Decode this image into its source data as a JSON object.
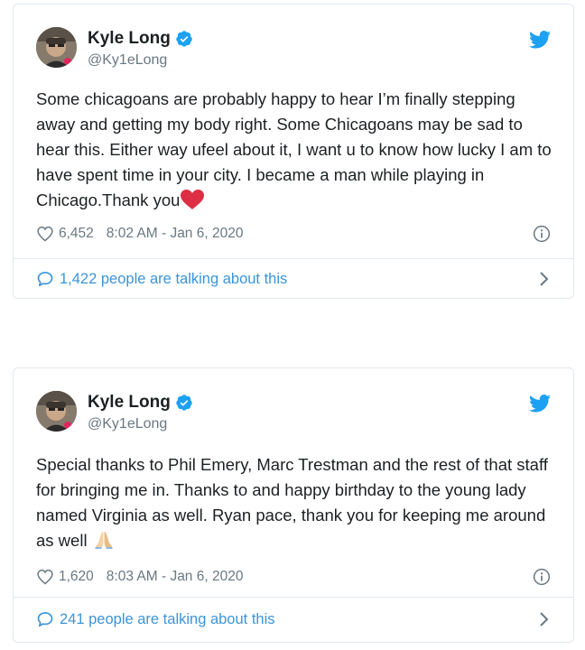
{
  "tweets": [
    {
      "author": {
        "name": "Kyle Long",
        "handle": "@Ky1eLong",
        "verified": true,
        "avatar_icon": "profile-photo"
      },
      "text": "Some chicagoans are probably happy to hear I’m finally stepping away and getting my body right. Some Chicagoans may be sad to hear this. Either way ufeel about it, I want u to know how lucky I am to have spent time in your city. I became a man while playing in Chicago.Thank you",
      "emoji": "❤️",
      "likes": "6,452",
      "timestamp": "8:02 AM - Jan 6, 2020",
      "conversation": "1,422 people are talking about this"
    },
    {
      "author": {
        "name": "Kyle Long",
        "handle": "@Ky1eLong",
        "verified": true,
        "avatar_icon": "profile-photo"
      },
      "text": "Special thanks to Phil Emery, Marc Trestman and the rest of that staff for bringing me in. Thanks to and happy birthday to the young lady named Virginia as well. Ryan pace, thank you for keeping me around as well",
      "emoji": "🙏🏼",
      "likes": "1,620",
      "timestamp": "8:03 AM - Jan 6, 2020",
      "conversation": "241 people are talking about this"
    }
  ],
  "colors": {
    "verified_blue": "#1da1f2",
    "twitter_blue": "#1da1f2",
    "link_blue": "#3b94d9",
    "meta_gray": "#697882",
    "border": "#e1e8ed",
    "heart_red": "#e0245e"
  },
  "icons": {
    "verified": "verified-badge-icon",
    "brand": "twitter-bird-icon",
    "like": "heart-outline-icon",
    "info": "info-icon",
    "conversation": "comment-bubble-icon",
    "expand": "chevron-right-icon"
  }
}
